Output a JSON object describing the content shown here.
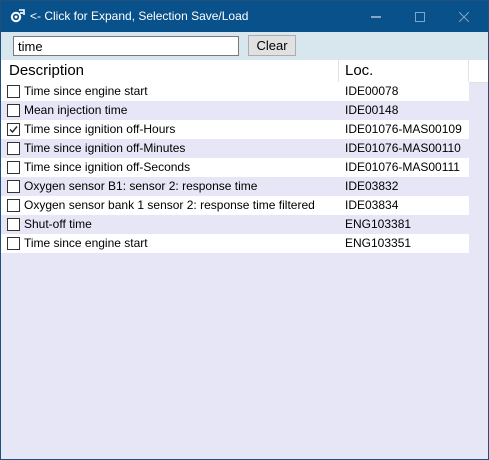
{
  "window": {
    "title": "<- Click for Expand, Selection Save/Load",
    "icon": "gear-app-icon"
  },
  "search": {
    "value": "time",
    "placeholder": ""
  },
  "toolbar": {
    "clear_label": "Clear"
  },
  "table": {
    "columns": {
      "description": "Description",
      "location": "Loc."
    },
    "rows": [
      {
        "checked": false,
        "description": "Time since engine start",
        "location": "IDE00078"
      },
      {
        "checked": false,
        "description": "Mean injection time",
        "location": "IDE00148"
      },
      {
        "checked": true,
        "description": "Time since ignition off-Hours",
        "location": "IDE01076-MAS00109"
      },
      {
        "checked": false,
        "description": "Time since ignition off-Minutes",
        "location": "IDE01076-MAS00110"
      },
      {
        "checked": false,
        "description": "Time since ignition off-Seconds",
        "location": "IDE01076-MAS00111"
      },
      {
        "checked": false,
        "description": "Oxygen sensor B1: sensor 2: response time",
        "location": "IDE03832"
      },
      {
        "checked": false,
        "description": "Oxygen sensor bank 1 sensor 2: response time filtered",
        "location": "IDE03834"
      },
      {
        "checked": false,
        "description": "Shut-off time",
        "location": "ENG103381"
      },
      {
        "checked": false,
        "description": "Time since engine start",
        "location": "ENG103351"
      }
    ]
  },
  "colors": {
    "titlebar": "#09518b",
    "search_band": "#d8e6ee",
    "grid_background": "#e6e6f6"
  }
}
